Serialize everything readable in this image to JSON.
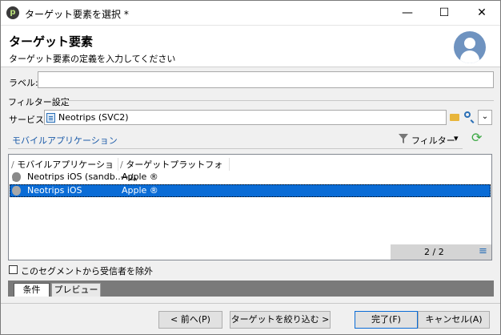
{
  "window": {
    "title": "ターゲット要素を選択 *",
    "minimize": "—",
    "maximize": "☐",
    "close": "✕",
    "app_icon_letter": "p"
  },
  "header": {
    "title": "ターゲット要素",
    "subtitle": "ターゲット要素の定義を入力してください"
  },
  "form": {
    "label_caption": "ラベル:",
    "label_value": "",
    "filter_section": "フィルター設定",
    "service_caption": "サービス:",
    "service_value": "Neotrips (SVC2)"
  },
  "list_section": {
    "title": "モバイルアプリケーション",
    "filter_label": "フィルター",
    "filter_arrow": "▾",
    "refresh_glyph": "⟳"
  },
  "grid": {
    "columns": [
      "モバイルアプリケーション",
      "ターゲットプラットフォーム"
    ],
    "sort_marks": [
      "∕",
      "∕"
    ],
    "rows": [
      {
        "app": "Neotrips iOS (sandb...",
        "platform": "Apple ®",
        "selected": false
      },
      {
        "app": "Neotrips iOS",
        "platform": "Apple ®",
        "selected": true
      }
    ],
    "count": "2 / 2",
    "menu_glyph": "≡"
  },
  "exclude_checkbox": {
    "label": "このセグメントから受信者を除外",
    "checked": false
  },
  "tabs": [
    "条件",
    "プレビュー"
  ],
  "buttons": {
    "prev": "< 前へ(P)",
    "refine": "ターゲットを絞り込む >",
    "finish": "完了(F)",
    "cancel": "キャンセル(A)"
  },
  "colors": {
    "selection": "#0a6cd6",
    "link": "#1a5aa8",
    "refresh": "#3aa843",
    "avatar": "#6f93c0"
  }
}
